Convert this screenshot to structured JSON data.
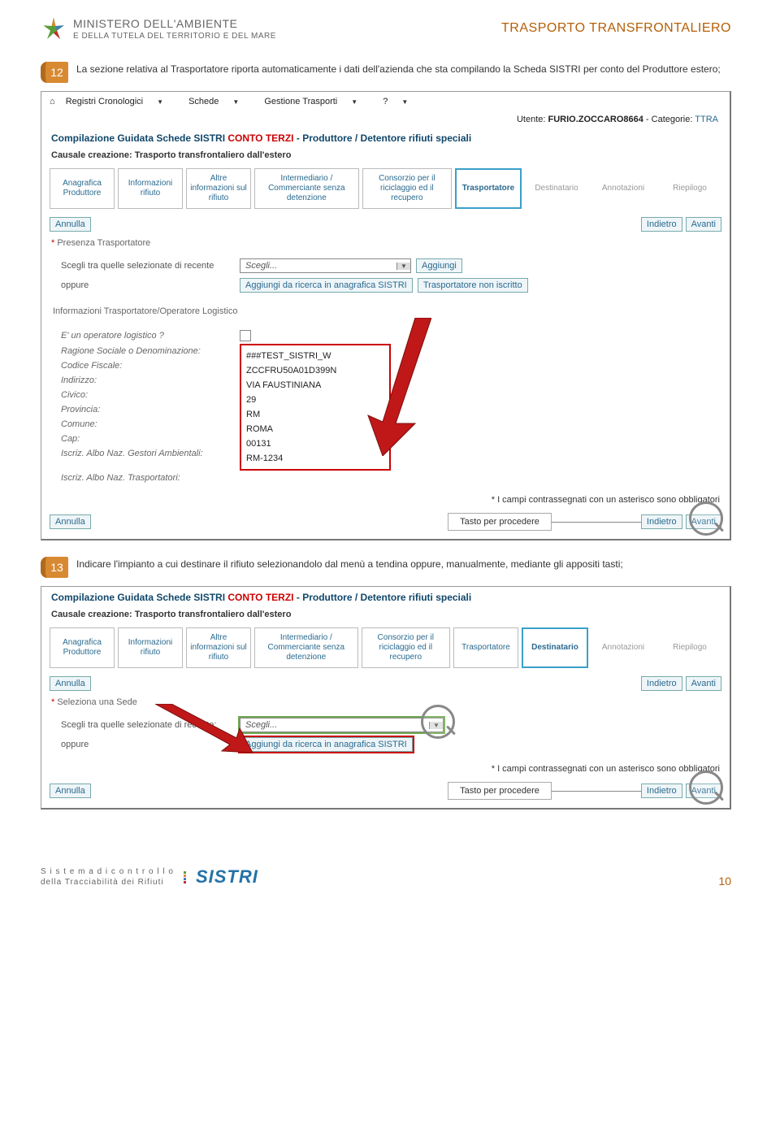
{
  "header": {
    "ministry_main": "MINISTERO DELL'AMBIENTE",
    "ministry_sub": "E DELLA TUTELA DEL TERRITORIO E DEL MARE",
    "title": "TRASPORTO TRANSFRONTALIERO"
  },
  "step12": {
    "num": "12",
    "text": "La sezione relativa al Trasportatore riporta automaticamente i dati dell'azienda che sta compilando la Scheda SISTRI per conto del Produttore estero;"
  },
  "sc1": {
    "menu": {
      "registri": "Registri Cronologici",
      "schede": "Schede",
      "gestione": "Gestione Trasporti",
      "help": "?"
    },
    "user_label": "Utente:",
    "user_value": "FURIO.ZOCCARO8664",
    "user_cat_label": "- Categorie:",
    "user_cat_value": "TTRA",
    "title_pre": "Compilazione Guidata Schede SISTRI",
    "title_red": "CONTO TERZI",
    "title_post": "- Produttore / Detentore rifiuti speciali",
    "subtitle": "Causale creazione: Trasporto transfrontaliero dall'estero",
    "tabs": [
      "Anagrafica Produttore",
      "Informazioni rifiuto",
      "Altre informazioni sul rifiuto",
      "Intermediario / Commerciante senza detenzione",
      "Consorzio per il riciclaggio ed il recupero",
      "Trasportatore",
      "Destinatario",
      "Annotazioni",
      "Riepilogo"
    ],
    "btn_annulla": "Annulla",
    "btn_indietro": "Indietro",
    "btn_avanti": "Avanti",
    "field_presenza": "Presenza Trasportatore",
    "scegli_label": "Scegli tra quelle selezionate di recente",
    "oppure": "oppure",
    "scegli_placeholder": "Scegli...",
    "btn_aggiungi": "Aggiungi",
    "btn_aggiungi_ricerca": "Aggiungi da ricerca in anagrafica SISTRI",
    "btn_non_iscritto": "Trasportatore non iscritto",
    "info_title": "Informazioni Trasportatore/Operatore Logistico",
    "rows": {
      "op_log": "E' un operatore logistico ?",
      "ragione": "Ragione Sociale o Denominazione:",
      "cf": "Codice Fiscale:",
      "indirizzo": "Indirizzo:",
      "civico": "Civico:",
      "provincia": "Provincia:",
      "comune": "Comune:",
      "cap": "Cap:",
      "albo_ga": "Iscriz. Albo Naz. Gestori Ambientali:",
      "albo_tr": "Iscriz. Albo Naz. Trasportatori:"
    },
    "vals": {
      "ragione": "###TEST_SISTRI_W",
      "cf": "ZCCFRU50A01D399N",
      "indirizzo": "VIA FAUSTINIANA",
      "civico": "29",
      "provincia": "RM",
      "comune": "ROMA",
      "cap": "00131",
      "albo_ga": "RM-1234"
    },
    "footnote": "I campi contrassegnati con un asterisco sono obbligatori",
    "callout": "Tasto per procedere"
  },
  "step13": {
    "num": "13",
    "text": "Indicare l'impianto a cui destinare il rifiuto selezionandolo dal menù a tendina oppure, manualmente, mediante gli appositi tasti;"
  },
  "sc2": {
    "title_pre": "Compilazione Guidata Schede SISTRI",
    "title_red": "CONTO TERZI",
    "title_post": "- Produttore / Detentore rifiuti speciali",
    "subtitle": "Causale creazione: Trasporto transfrontaliero dall'estero",
    "tabs": [
      "Anagrafica Produttore",
      "Informazioni rifiuto",
      "Altre informazioni sul rifiuto",
      "Intermediario / Commerciante senza detenzione",
      "Consorzio per il riciclaggio ed il recupero",
      "Trasportatore",
      "Destinatario",
      "Annotazioni",
      "Riepilogo"
    ],
    "btn_annulla": "Annulla",
    "btn_indietro": "Indietro",
    "btn_avanti": "Avanti",
    "field_sede": "Seleziona una Sede",
    "scegli_label": "Scegli tra quelle selezionate di recente:",
    "oppure": "oppure",
    "scegli_placeholder": "Scegli...",
    "btn_aggiungi_ricerca": "Aggiungi da ricerca in anagrafica SISTRI",
    "footnote": "I campi contrassegnati con un asterisco sono obbligatori",
    "callout": "Tasto per procedere"
  },
  "footer": {
    "line1": "S i s t e m a   d i   c o n t r o l l o",
    "line2": "della Tracciabilità dei Rifiuti",
    "logo": "SISTRI",
    "page": "10"
  }
}
